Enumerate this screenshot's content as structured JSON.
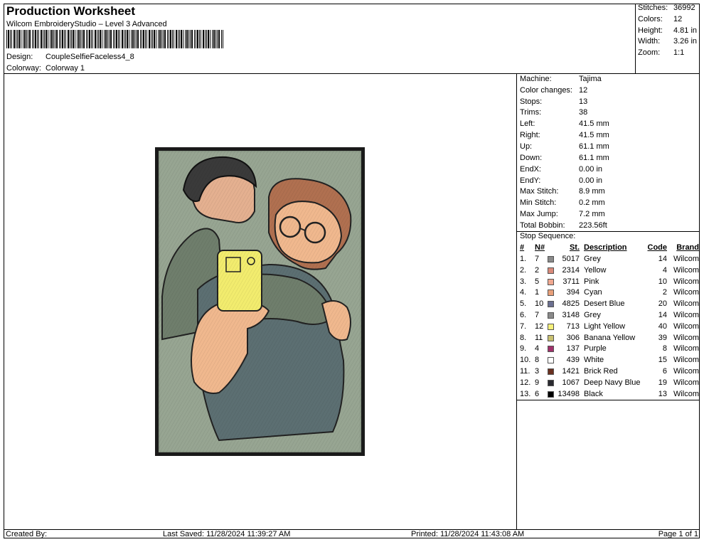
{
  "header": {
    "title": "Production Worksheet",
    "software": "Wilcom EmbroideryStudio – Level 3 Advanced",
    "design_label": "Design:",
    "design_value": "CoupleSelfieFaceless4_8",
    "colorway_label": "Colorway:",
    "colorway_value": "Colorway 1"
  },
  "stats": [
    {
      "label": "Stitches:",
      "value": "36992"
    },
    {
      "label": "Colors:",
      "value": "12"
    },
    {
      "label": "Height:",
      "value": "4.81 in"
    },
    {
      "label": "Width:",
      "value": "3.26 in"
    },
    {
      "label": "Zoom:",
      "value": "1:1"
    }
  ],
  "machine_info": [
    {
      "label": "Machine:",
      "value": "Tajima"
    },
    {
      "label": "Color changes:",
      "value": "12"
    },
    {
      "label": "Stops:",
      "value": "13"
    },
    {
      "label": "Trims:",
      "value": "38"
    },
    {
      "label": "Left:",
      "value": "41.5 mm"
    },
    {
      "label": "Right:",
      "value": "41.5 mm"
    },
    {
      "label": "Up:",
      "value": "61.1 mm"
    },
    {
      "label": "Down:",
      "value": "61.1 mm"
    },
    {
      "label": "EndX:",
      "value": "0.00 in"
    },
    {
      "label": "EndY:",
      "value": "0.00 in"
    },
    {
      "label": "Max Stitch:",
      "value": "8.9 mm"
    },
    {
      "label": "Min Stitch:",
      "value": "0.2 mm"
    },
    {
      "label": "Max Jump:",
      "value": "7.2 mm"
    },
    {
      "label": "Total Bobbin:",
      "value": "223.56ft"
    }
  ],
  "stop_sequence": {
    "title": "Stop Sequence:",
    "headers": {
      "idx": "#",
      "n": "N#",
      "st": "St.",
      "desc": "Description",
      "code": "Code",
      "brand": "Brand"
    },
    "rows": [
      {
        "idx": "1.",
        "n": "7",
        "swatch": "#8a8a8a",
        "st": "5017",
        "desc": "Grey",
        "code": "14",
        "brand": "Wilcom"
      },
      {
        "idx": "2.",
        "n": "2",
        "swatch": "#d98a7a",
        "st": "2314",
        "desc": "Yellow",
        "code": "4",
        "brand": "Wilcom"
      },
      {
        "idx": "3.",
        "n": "5",
        "swatch": "#f0a890",
        "st": "3711",
        "desc": "Pink",
        "code": "10",
        "brand": "Wilcom"
      },
      {
        "idx": "4.",
        "n": "1",
        "swatch": "#e8a07a",
        "st": "394",
        "desc": "Cyan",
        "code": "2",
        "brand": "Wilcom"
      },
      {
        "idx": "5.",
        "n": "10",
        "swatch": "#6b7090",
        "st": "4825",
        "desc": "Desert Blue",
        "code": "20",
        "brand": "Wilcom"
      },
      {
        "idx": "6.",
        "n": "7",
        "swatch": "#8a8a8a",
        "st": "3148",
        "desc": "Grey",
        "code": "14",
        "brand": "Wilcom"
      },
      {
        "idx": "7.",
        "n": "12",
        "swatch": "#f5f07a",
        "st": "713",
        "desc": "Light Yellow",
        "code": "40",
        "brand": "Wilcom"
      },
      {
        "idx": "8.",
        "n": "11",
        "swatch": "#c8c070",
        "st": "306",
        "desc": "Banana Yellow",
        "code": "39",
        "brand": "Wilcom"
      },
      {
        "idx": "9.",
        "n": "4",
        "swatch": "#a0306a",
        "st": "137",
        "desc": "Purple",
        "code": "8",
        "brand": "Wilcom"
      },
      {
        "idx": "10.",
        "n": "8",
        "swatch": "#ffffff",
        "st": "439",
        "desc": "White",
        "code": "15",
        "brand": "Wilcom"
      },
      {
        "idx": "11.",
        "n": "3",
        "swatch": "#6a3020",
        "st": "1421",
        "desc": "Brick Red",
        "code": "6",
        "brand": "Wilcom"
      },
      {
        "idx": "12.",
        "n": "9",
        "swatch": "#2a2a30",
        "st": "1067",
        "desc": "Deep Navy Blue",
        "code": "19",
        "brand": "Wilcom"
      },
      {
        "idx": "13.",
        "n": "6",
        "swatch": "#000000",
        "st": "13498",
        "desc": "Black",
        "code": "13",
        "brand": "Wilcom"
      }
    ]
  },
  "footer": {
    "created_by": "Created By:",
    "last_saved": "Last Saved: 11/28/2024 11:39:27 AM",
    "printed": "Printed: 11/28/2024 11:43:08 AM",
    "page": "Page 1 of 1"
  }
}
